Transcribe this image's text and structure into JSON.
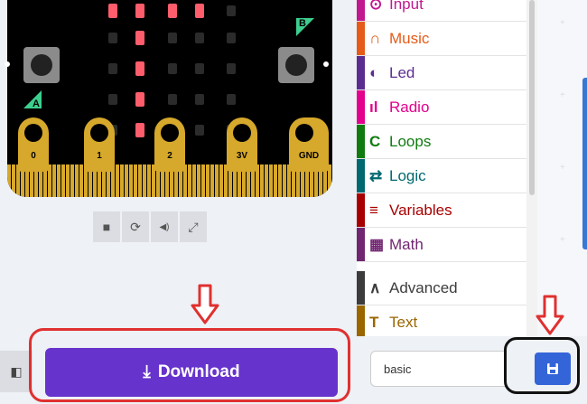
{
  "simulator": {
    "button_a_label": "A",
    "button_b_label": "B",
    "pins": [
      "0",
      "1",
      "2",
      "3V",
      "GND"
    ],
    "led_rows": [
      [
        1,
        1,
        1,
        1,
        0
      ],
      [
        0,
        1,
        0,
        0,
        0
      ],
      [
        0,
        1,
        0,
        0,
        0
      ],
      [
        0,
        1,
        0,
        0,
        0
      ],
      [
        0,
        1,
        0,
        0,
        0
      ],
      [
        0,
        0,
        0,
        0,
        0
      ]
    ],
    "controls": [
      {
        "name": "stop-icon",
        "glyph": "■"
      },
      {
        "name": "restart-icon",
        "glyph": "⟳"
      },
      {
        "name": "mute-icon",
        "glyph": "◀)"
      },
      {
        "name": "fullscreen-icon",
        "glyph": "⤢"
      }
    ]
  },
  "download": {
    "label": "Download",
    "icon": "⤓"
  },
  "toolbox": {
    "categories": [
      {
        "label": "Input",
        "icon": "⊙",
        "color": "#c2188f"
      },
      {
        "label": "Music",
        "icon": "∩",
        "color": "#e55b19"
      },
      {
        "label": "Led",
        "icon": "◐",
        "color": "#5c2d91"
      },
      {
        "label": "Radio",
        "icon": "ıl",
        "color": "#e3008c"
      },
      {
        "label": "Loops",
        "icon": "C",
        "color": "#107c10"
      },
      {
        "label": "Logic",
        "icon": "⇄",
        "color": "#006970"
      },
      {
        "label": "Variables",
        "icon": "≡",
        "color": "#a80000"
      },
      {
        "label": "Math",
        "icon": "▦",
        "color": "#712672"
      }
    ],
    "advanced": [
      {
        "label": "Advanced",
        "icon": "∧",
        "color": "#3c3c3c"
      },
      {
        "label": "Text",
        "icon": "T",
        "color": "#996600"
      }
    ]
  },
  "project": {
    "name": "basic",
    "save_icon": "💾"
  },
  "colors": {
    "download": "#6633cc",
    "save": "#3465d8",
    "highlight_red": "#e03030"
  }
}
